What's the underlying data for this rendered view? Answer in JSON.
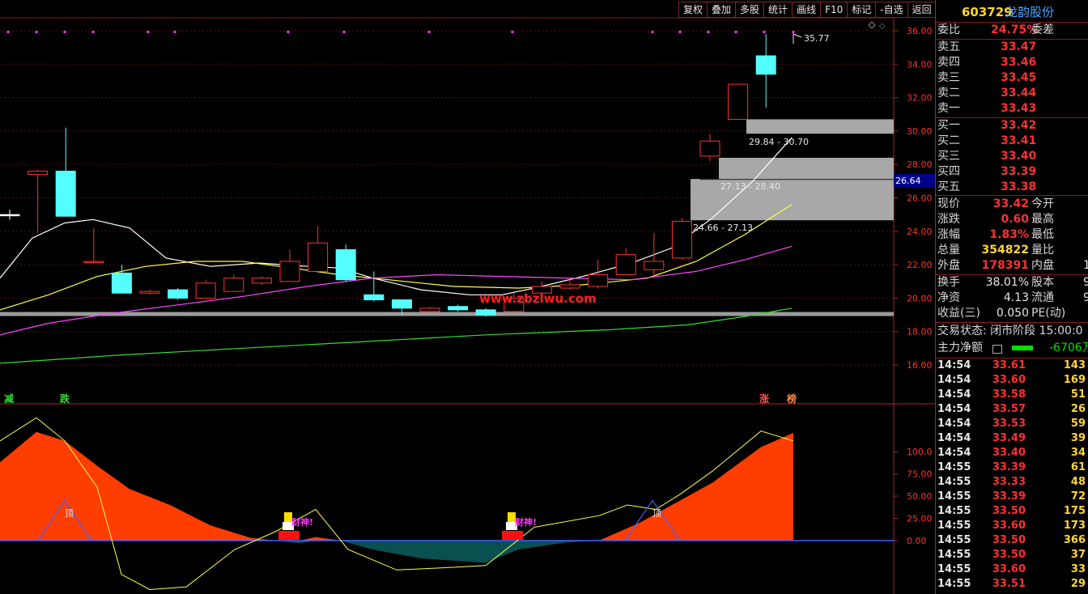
{
  "toolbar": {
    "buttons": [
      "复权",
      "叠加",
      "多股",
      "统计",
      "画线",
      "F10",
      "标记",
      "-自选",
      "返回"
    ]
  },
  "chart": {
    "y_axis_ticks": [
      "36.00",
      "34.00",
      "32.00",
      "30.00",
      "28.00",
      "26.00",
      "24.00",
      "22.00",
      "20.00",
      "18.00",
      "16.00"
    ],
    "current_price_tag": "26.64",
    "high_label": "35.77",
    "zone_labels": [
      "29.84 - 30.70",
      "27.13 - 28.40",
      "24.66 - 27.13"
    ],
    "watermark": "www.zbzlwu.com",
    "signal_reduce": "减",
    "signal_fall": "跌",
    "signal_up": "涨",
    "signal_rank": "榜",
    "indicator_ticks": [
      "100.0",
      "75.00",
      "50.00",
      "25.00",
      "0.00"
    ],
    "indicator_marks": [
      "顶",
      "财神!",
      "财神!",
      "顶"
    ]
  },
  "chart_data": {
    "type": "candlestick",
    "ylim": [
      15.5,
      37
    ],
    "candles": [
      {
        "o": 25.0,
        "c": 25.0,
        "h": 25.3,
        "l": 24.7,
        "color": "white"
      },
      {
        "o": 27.4,
        "c": 27.6,
        "h": 27.7,
        "l": 23.9,
        "color": "red"
      },
      {
        "o": 27.6,
        "c": 24.9,
        "h": 30.2,
        "l": 24.9,
        "color": "cyan"
      },
      {
        "o": 22.2,
        "c": 22.2,
        "h": 24.2,
        "l": 22.2,
        "color": "red"
      },
      {
        "o": 21.5,
        "c": 20.3,
        "h": 22.0,
        "l": 20.3,
        "color": "cyan"
      },
      {
        "o": 20.3,
        "c": 20.4,
        "h": 20.5,
        "l": 20.2,
        "color": "red"
      },
      {
        "o": 20.5,
        "c": 20.0,
        "h": 20.6,
        "l": 19.9,
        "color": "cyan"
      },
      {
        "o": 20.0,
        "c": 20.9,
        "h": 21.1,
        "l": 20.0,
        "color": "red"
      },
      {
        "o": 20.4,
        "c": 21.2,
        "h": 21.4,
        "l": 20.4,
        "color": "red"
      },
      {
        "o": 20.9,
        "c": 21.2,
        "h": 21.3,
        "l": 20.8,
        "color": "red"
      },
      {
        "o": 21.0,
        "c": 22.2,
        "h": 22.9,
        "l": 21.0,
        "color": "red"
      },
      {
        "o": 21.6,
        "c": 23.3,
        "h": 24.3,
        "l": 21.5,
        "color": "red"
      },
      {
        "o": 22.9,
        "c": 21.1,
        "h": 23.2,
        "l": 21.0,
        "color": "cyan"
      },
      {
        "o": 20.2,
        "c": 19.9,
        "h": 21.6,
        "l": 19.8,
        "color": "cyan"
      },
      {
        "o": 19.9,
        "c": 19.4,
        "h": 19.9,
        "l": 19.0,
        "color": "cyan"
      },
      {
        "o": 19.2,
        "c": 19.4,
        "h": 19.5,
        "l": 19.2,
        "color": "red"
      },
      {
        "o": 19.5,
        "c": 19.3,
        "h": 19.6,
        "l": 19.2,
        "color": "cyan"
      },
      {
        "o": 19.3,
        "c": 19.0,
        "h": 19.4,
        "l": 18.9,
        "color": "cyan"
      },
      {
        "o": 19.2,
        "c": 20.0,
        "h": 20.3,
        "l": 19.1,
        "color": "red"
      },
      {
        "o": 20.3,
        "c": 20.7,
        "h": 21.0,
        "l": 20.2,
        "color": "red"
      },
      {
        "o": 20.6,
        "c": 20.8,
        "h": 21.2,
        "l": 20.5,
        "color": "red"
      },
      {
        "o": 20.7,
        "c": 21.4,
        "h": 22.3,
        "l": 20.6,
        "color": "red"
      },
      {
        "o": 21.4,
        "c": 22.6,
        "h": 23.0,
        "l": 21.4,
        "color": "red"
      },
      {
        "o": 21.7,
        "c": 22.2,
        "h": 23.9,
        "l": 21.2,
        "color": "red"
      },
      {
        "o": 22.4,
        "c": 24.6,
        "h": 24.8,
        "l": 22.3,
        "color": "red"
      },
      {
        "o": 28.5,
        "c": 29.4,
        "h": 29.8,
        "l": 28.2,
        "color": "red"
      },
      {
        "o": 30.7,
        "c": 32.8,
        "h": 32.8,
        "l": 30.7,
        "color": "red"
      },
      {
        "o": 34.5,
        "c": 33.4,
        "h": 35.8,
        "l": 31.4,
        "color": "cyan"
      }
    ]
  },
  "quote": {
    "code": "603729",
    "name": "龙韵股份",
    "webi_label": "委比",
    "webi_value": "24.75%",
    "weicha_label": "委差",
    "sell": [
      {
        "label": "卖五",
        "price": "33.47"
      },
      {
        "label": "卖四",
        "price": "33.46"
      },
      {
        "label": "卖三",
        "price": "33.45"
      },
      {
        "label": "卖二",
        "price": "33.44"
      },
      {
        "label": "卖一",
        "price": "33.43"
      }
    ],
    "buy": [
      {
        "label": "买一",
        "price": "33.42"
      },
      {
        "label": "买二",
        "price": "33.41"
      },
      {
        "label": "买三",
        "price": "33.40"
      },
      {
        "label": "买四",
        "price": "33.39"
      },
      {
        "label": "买五",
        "price": "33.38"
      }
    ],
    "stats": [
      {
        "label": "现价",
        "value": "33.42",
        "label2": "今开",
        "tail": ""
      },
      {
        "label": "涨跌",
        "value": "0.60",
        "label2": "最高",
        "tail": ""
      },
      {
        "label": "涨幅",
        "value": "1.83%",
        "label2": "最低",
        "tail": ""
      },
      {
        "label": "总量",
        "value": "354822",
        "label2": "量比",
        "tail": ""
      },
      {
        "label": "外盘",
        "value": "178391",
        "label2": "内盘",
        "tail": "1"
      }
    ],
    "stats2": [
      {
        "label": "换手",
        "value": "38.01%",
        "label2": "股本",
        "tail": "9"
      },
      {
        "label": "净资",
        "value": "4.13",
        "label2": "流通",
        "tail": "9"
      },
      {
        "label": "收益(三)",
        "value": "0.050",
        "label2": "PE(动)",
        "tail": ""
      }
    ],
    "trade_status": "交易状态: 闭市阶段 15:00:0",
    "main_net_label": "主力净额",
    "main_net_value": "-6706万"
  },
  "ticks": [
    {
      "time": "14:54",
      "price": "33.61",
      "vol": "143"
    },
    {
      "time": "14:54",
      "price": "33.60",
      "vol": "169"
    },
    {
      "time": "14:54",
      "price": "33.58",
      "vol": "51"
    },
    {
      "time": "14:54",
      "price": "33.57",
      "vol": "26"
    },
    {
      "time": "14:54",
      "price": "33.53",
      "vol": "59"
    },
    {
      "time": "14:54",
      "price": "33.49",
      "vol": "39"
    },
    {
      "time": "14:54",
      "price": "33.40",
      "vol": "34"
    },
    {
      "time": "14:55",
      "price": "33.39",
      "vol": "61"
    },
    {
      "time": "14:55",
      "price": "33.33",
      "vol": "48"
    },
    {
      "time": "14:55",
      "price": "33.39",
      "vol": "72"
    },
    {
      "time": "14:55",
      "price": "33.50",
      "vol": "175"
    },
    {
      "time": "14:55",
      "price": "33.60",
      "vol": "173"
    },
    {
      "time": "14:55",
      "price": "33.50",
      "vol": "366"
    },
    {
      "time": "14:55",
      "price": "33.50",
      "vol": "37"
    },
    {
      "time": "14:55",
      "price": "33.60",
      "vol": "33"
    },
    {
      "time": "14:55",
      "price": "33.51",
      "vol": "29"
    }
  ],
  "colors": {
    "up": "#ff3030",
    "down": "#54ffff",
    "ma5": "#ffffff",
    "ma10": "#ffff44",
    "ma20": "#ff44ff",
    "ma60": "#33dd33",
    "indicator_fill": "#ff3d00",
    "indicator_neg": "#0a5050"
  }
}
